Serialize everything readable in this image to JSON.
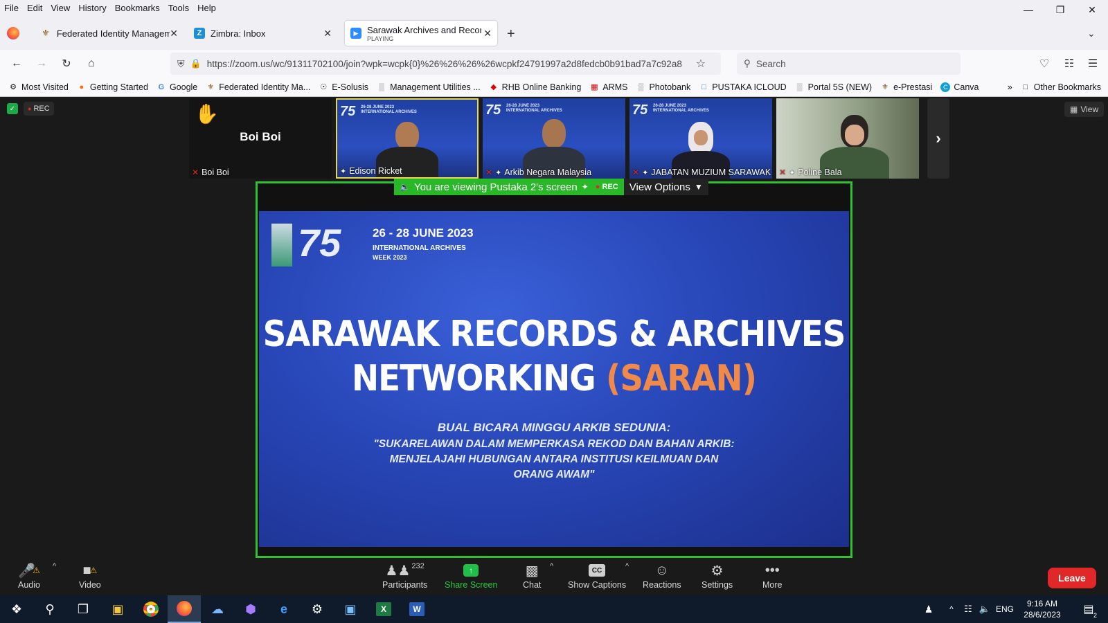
{
  "menubar": {
    "items": [
      "File",
      "Edit",
      "View",
      "History",
      "Bookmarks",
      "Tools",
      "Help"
    ]
  },
  "tabs": [
    {
      "title": "Federated Identity Managemen",
      "close": "✕"
    },
    {
      "title": "Zimbra: Inbox",
      "close": "✕"
    },
    {
      "title": "Sarawak Archives and Records N",
      "subtitle": "PLAYING",
      "close": "✕"
    }
  ],
  "new_tab": "+",
  "url": "https://zoom.us/wc/91311702100/join?wpk=wcpk{0}%26%26%26%26wcpkf24791997a2d8fedcb0b91bad7a7c92a8",
  "search_placeholder": "Search",
  "bookmarks": [
    "Most Visited",
    "Getting Started",
    "Google",
    "Federated Identity Ma...",
    "E-Solusis",
    "Management Utilities ...",
    "RHB Online Banking",
    "ARMS",
    "Photobank",
    "PUSTAKA ICLOUD",
    "Portal 5S (NEW)",
    "e-Prestasi",
    "Canva"
  ],
  "other_bookmarks": "Other Bookmarks",
  "zoom": {
    "rec": "REC",
    "view_btn": "View",
    "participants_strip": [
      {
        "name": "Boi Boi",
        "display": "Boi Boi"
      },
      {
        "name": "Edison Ricket"
      },
      {
        "name": "Arkib Negara Malaysia"
      },
      {
        "name": "JABATAN MUZIUM SARAWAK"
      },
      {
        "name": "Poline Bala"
      }
    ],
    "viewing_banner": "You are viewing Pustaka 2's screen",
    "banner_rec": "REC",
    "view_options": "View Options",
    "slide": {
      "date": "26 - 28 JUNE 2023",
      "event": "INTERNATIONAL ARCHIVES",
      "event2": "WEEK 2023",
      "title_line1": "SARAWAK RECORDS & ARCHIVES",
      "title_line2a": "NETWORKING ",
      "title_line2b": "(SARAN)",
      "sub1": "BUAL BICARA MINGGU ARKIB SEDUNIA:",
      "sub2": "\"SUKARELAWAN DALAM MEMPERKASA REKOD DAN BAHAN ARKIB:",
      "sub3": "MENJELAJAHI HUBUNGAN ANTARA INSTITUSI KEILMUAN DAN",
      "sub4": "ORANG AWAM\""
    },
    "toolbar": {
      "audio": "Audio",
      "video": "Video",
      "participants": "Participants",
      "participants_count": "232",
      "share_screen": "Share Screen",
      "chat": "Chat",
      "captions": "Show Captions",
      "reactions": "Reactions",
      "settings": "Settings",
      "more": "More",
      "leave": "Leave"
    }
  },
  "taskbar": {
    "lang": "ENG",
    "time": "9:16 AM",
    "date": "28/6/2023",
    "notif_count": "2"
  },
  "colors": {
    "zoom_green": "#28b828",
    "leave_red": "#e02828",
    "slide_blue": "#2847b8",
    "saran_orange": "#f08a4b"
  }
}
